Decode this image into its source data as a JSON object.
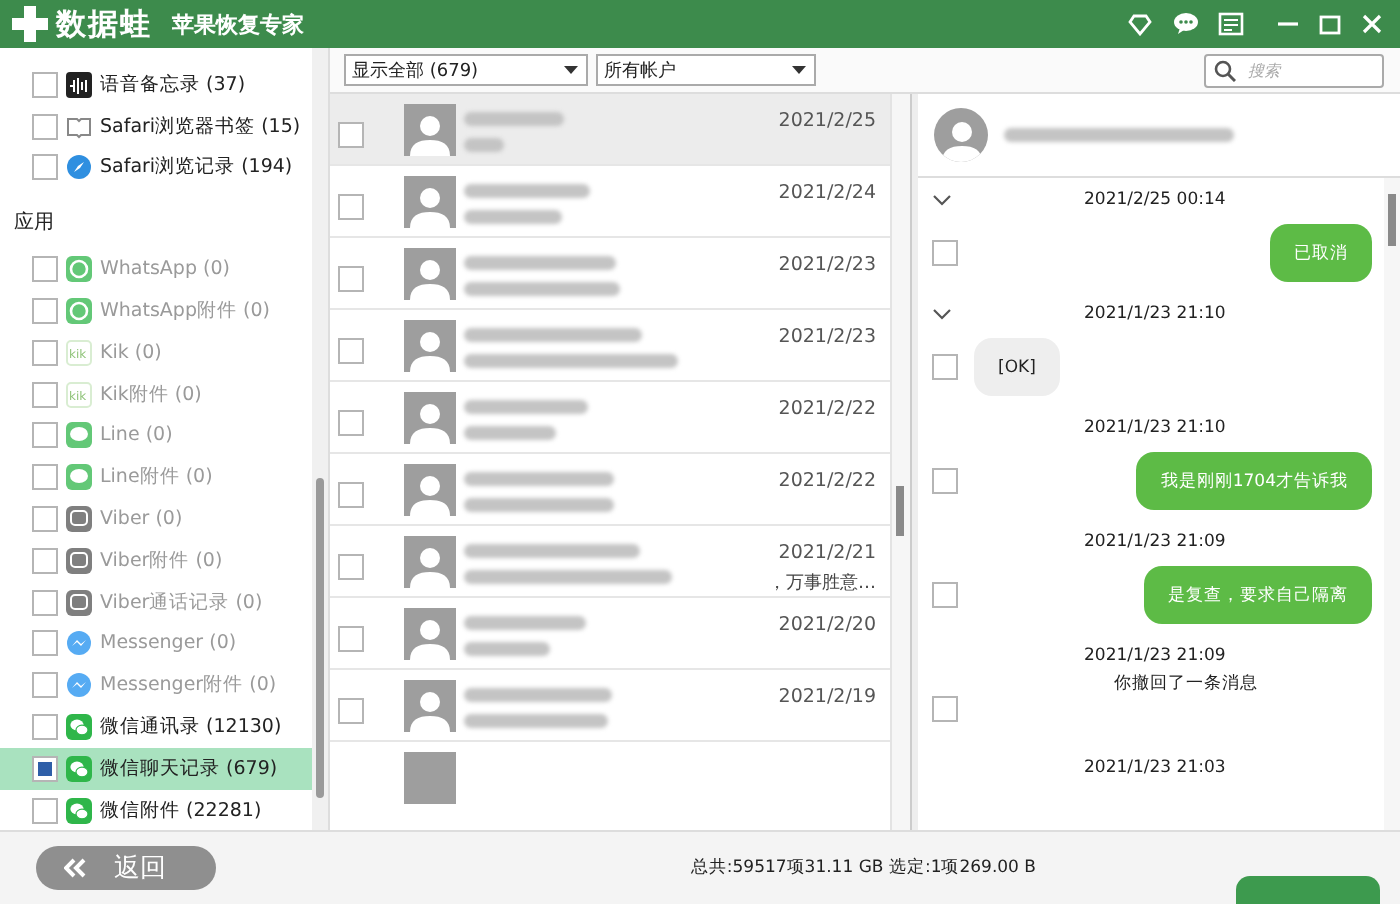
{
  "title_bar": {
    "logo_text": "数据蛙",
    "subtitle": "苹果恢复专家"
  },
  "sidebar": {
    "items": [
      {
        "label": "语音备忘录 (37)",
        "kind": "voice-memo",
        "checked": false,
        "disabled": false,
        "selected": false
      },
      {
        "label": "Safari浏览器书签 (15)",
        "kind": "bookmark",
        "checked": false,
        "disabled": false,
        "selected": false
      },
      {
        "label": "Safari浏览记录 (194)",
        "kind": "safari",
        "checked": false,
        "disabled": false,
        "selected": false
      },
      {
        "label": "应用",
        "kind": "heading"
      },
      {
        "label": "WhatsApp (0)",
        "kind": "whatsapp",
        "checked": false,
        "disabled": true,
        "selected": false
      },
      {
        "label": "WhatsApp附件 (0)",
        "kind": "whatsapp",
        "checked": false,
        "disabled": true,
        "selected": false
      },
      {
        "label": "Kik (0)",
        "kind": "kik",
        "checked": false,
        "disabled": true,
        "selected": false
      },
      {
        "label": "Kik附件 (0)",
        "kind": "kik",
        "checked": false,
        "disabled": true,
        "selected": false
      },
      {
        "label": "Line (0)",
        "kind": "line",
        "checked": false,
        "disabled": true,
        "selected": false
      },
      {
        "label": "Line附件 (0)",
        "kind": "line",
        "checked": false,
        "disabled": true,
        "selected": false
      },
      {
        "label": "Viber (0)",
        "kind": "viber",
        "checked": false,
        "disabled": true,
        "selected": false
      },
      {
        "label": "Viber附件 (0)",
        "kind": "viber",
        "checked": false,
        "disabled": true,
        "selected": false
      },
      {
        "label": "Viber通话记录 (0)",
        "kind": "viber",
        "checked": false,
        "disabled": true,
        "selected": false
      },
      {
        "label": "Messenger (0)",
        "kind": "messenger",
        "checked": false,
        "disabled": true,
        "selected": false
      },
      {
        "label": "Messenger附件 (0)",
        "kind": "messenger",
        "checked": false,
        "disabled": true,
        "selected": false
      },
      {
        "label": "微信通讯录 (12130)",
        "kind": "wechat",
        "checked": false,
        "disabled": false,
        "selected": false
      },
      {
        "label": "微信聊天记录 (679)",
        "kind": "wechat",
        "checked": true,
        "disabled": false,
        "selected": true
      },
      {
        "label": "微信附件 (22281)",
        "kind": "wechat",
        "checked": false,
        "disabled": false,
        "selected": false
      }
    ]
  },
  "toolbar": {
    "filter": "显示全部 (679)",
    "account": "所有帐户",
    "search": {
      "placeholder": "搜索"
    }
  },
  "conversations": [
    {
      "date": "2021/2/25",
      "checked": false,
      "selected": true
    },
    {
      "date": "2021/2/24",
      "checked": false,
      "selected": false
    },
    {
      "date": "2021/2/23",
      "checked": false,
      "selected": false
    },
    {
      "date": "2021/2/23",
      "checked": false,
      "selected": false
    },
    {
      "date": "2021/2/22",
      "checked": false,
      "selected": false
    },
    {
      "date": "2021/2/22",
      "checked": false,
      "selected": false
    },
    {
      "date": "2021/2/21",
      "preview": "，万事胜意…",
      "checked": false,
      "selected": false
    },
    {
      "date": "2021/2/20",
      "checked": false,
      "selected": false
    },
    {
      "date": "2021/2/19",
      "checked": false,
      "selected": false
    }
  ],
  "chat": {
    "messages": [
      {
        "time": "2021/2/25 00:14",
        "kind": "sent",
        "text": "已取消",
        "expanded": true,
        "checked": false
      },
      {
        "time": "2021/1/23 21:10",
        "kind": "received",
        "text": "[OK]",
        "expanded": true,
        "checked": false
      },
      {
        "time": "2021/1/23 21:10",
        "kind": "sent",
        "text": "我是刚刚1704才告诉我",
        "expanded": false,
        "checked": false
      },
      {
        "time": "2021/1/23 21:09",
        "kind": "sent",
        "text": "是复查，要求自己隔离",
        "expanded": false,
        "checked": false
      },
      {
        "time": "2021/1/23 21:09",
        "kind": "notice",
        "text": "你撤回了一条消息",
        "expanded": false,
        "checked": false
      },
      {
        "time": "2021/1/23 21:03",
        "kind": "time-only",
        "expanded": false
      }
    ]
  },
  "status_bar": {
    "back_label": "返回",
    "summary": "总共:59517项31.11 GB 选定:1项269.00 B"
  }
}
